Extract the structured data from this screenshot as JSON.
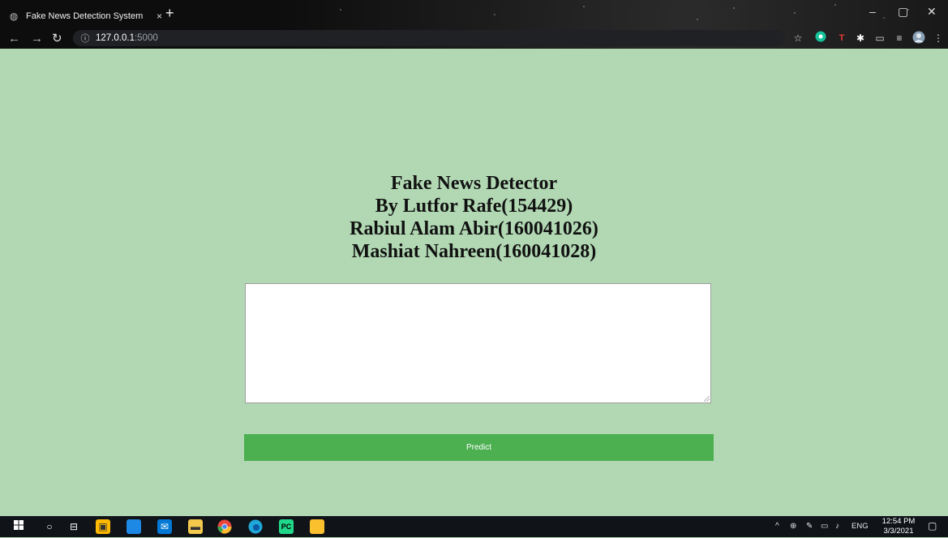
{
  "browser": {
    "tab_title": "Fake News Detection System",
    "tab_close": "×",
    "new_tab": "+",
    "url_host": "127.0.0.1",
    "url_port": ":5000"
  },
  "page": {
    "heading_lines": [
      "Fake News Detector",
      "By Lutfor Rafe(154429)",
      "Rabiul Alam Abir(160041026)",
      "Mashiat Nahreen(160041028)"
    ],
    "textarea_value": "",
    "predict_label": "Predict"
  },
  "taskbar": {
    "language": "ENG",
    "time": "12:54 PM",
    "date": "3/3/2021"
  },
  "colors": {
    "page_background": "#b1d8b3",
    "button": "#4caf50",
    "taskbar": "#101418"
  }
}
